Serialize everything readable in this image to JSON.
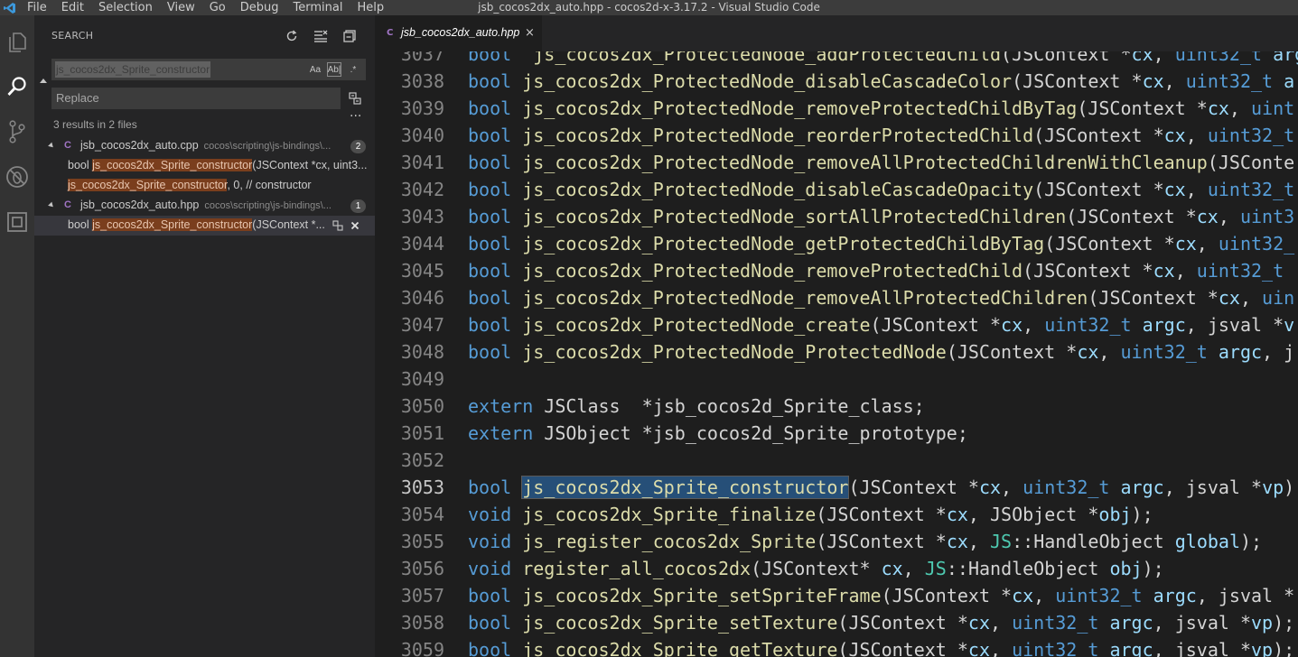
{
  "window": {
    "title": "jsb_cocos2dx_auto.hpp - cocos2d-x-3.17.2 - Visual Studio Code",
    "menu": [
      "File",
      "Edit",
      "Selection",
      "View",
      "Go",
      "Debug",
      "Terminal",
      "Help"
    ]
  },
  "activity_bar": {
    "items": [
      "explorer-icon",
      "search-icon",
      "source-control-icon",
      "debug-icon",
      "extensions-icon"
    ],
    "active": "search-icon"
  },
  "search": {
    "title": "SEARCH",
    "query": "js_cocos2dx_Sprite_constructor",
    "options": [
      "Aa",
      "Ab|",
      ".*"
    ],
    "replace_placeholder": "Replace",
    "more": "...",
    "results_summary": "3 results in 2 files",
    "files": [
      {
        "name": "jsb_cocos2dx_auto.cpp",
        "path": "cocos\\scripting\\js-bindings\\...",
        "icon": "C",
        "count": "2",
        "matches": [
          {
            "before": "bool ",
            "match": "js_cocos2dx_Sprite_constructor",
            "after": "(JSContext *cx, uint3..."
          },
          {
            "before": "",
            "match": "js_cocos2dx_Sprite_constructor",
            "after": ", 0, // constructor"
          }
        ]
      },
      {
        "name": "jsb_cocos2dx_auto.hpp",
        "path": "cocos\\scripting\\js-bindings\\...",
        "icon": "C",
        "count": "1",
        "matches": [
          {
            "before": "bool ",
            "match": "js_cocos2dx_Sprite_constructor",
            "after": "(JSContext *..."
          }
        ]
      }
    ]
  },
  "editor": {
    "tab_label": "jsb_cocos2dx_auto.hpp",
    "tab_icon": "C",
    "tab_close": "×",
    "current_line": "3053",
    "lines": [
      {
        "n": "3037",
        "tokens": [
          [
            "kw",
            "bool"
          ],
          [
            "",
            "  "
          ],
          [
            "fn",
            "js_cocos2dx_ProtectedNode_addProtectedChild"
          ],
          [
            "",
            "(JSContext *"
          ],
          [
            "pm",
            "cx"
          ],
          [
            "",
            ", "
          ],
          [
            "kw",
            "uint32_t"
          ],
          [
            "pm",
            " arg"
          ]
        ]
      },
      {
        "n": "3038",
        "tokens": [
          [
            "kw",
            "bool"
          ],
          [
            "",
            ""
          ],
          [
            "fn",
            " js_cocos2dx_ProtectedNode_disableCascadeColor"
          ],
          [
            "",
            "(JSContext *"
          ],
          [
            "pm",
            "cx"
          ],
          [
            "",
            ", "
          ],
          [
            "kw",
            "uint32_t"
          ],
          [
            "pm",
            " a"
          ]
        ]
      },
      {
        "n": "3039",
        "tokens": [
          [
            "kw",
            "bool"
          ],
          [
            "fn",
            " js_cocos2dx_ProtectedNode_removeProtectedChildByTag"
          ],
          [
            "",
            "(JSContext *"
          ],
          [
            "pm",
            "cx"
          ],
          [
            "",
            ", "
          ],
          [
            "kw",
            "uint"
          ]
        ]
      },
      {
        "n": "3040",
        "tokens": [
          [
            "kw",
            "bool"
          ],
          [
            "fn",
            " js_cocos2dx_ProtectedNode_reorderProtectedChild"
          ],
          [
            "",
            "(JSContext *"
          ],
          [
            "pm",
            "cx"
          ],
          [
            "",
            ", "
          ],
          [
            "kw",
            "uint32_t"
          ]
        ]
      },
      {
        "n": "3041",
        "tokens": [
          [
            "kw",
            "bool"
          ],
          [
            "fn",
            " js_cocos2dx_ProtectedNode_removeAllProtectedChildrenWithCleanup"
          ],
          [
            "",
            "(JSConte"
          ]
        ]
      },
      {
        "n": "3042",
        "tokens": [
          [
            "kw",
            "bool"
          ],
          [
            "fn",
            " js_cocos2dx_ProtectedNode_disableCascadeOpacity"
          ],
          [
            "",
            "(JSContext *"
          ],
          [
            "pm",
            "cx"
          ],
          [
            "",
            ", "
          ],
          [
            "kw",
            "uint32_t"
          ]
        ]
      },
      {
        "n": "3043",
        "tokens": [
          [
            "kw",
            "bool"
          ],
          [
            "fn",
            " js_cocos2dx_ProtectedNode_sortAllProtectedChildren"
          ],
          [
            "",
            "(JSContext *"
          ],
          [
            "pm",
            "cx"
          ],
          [
            "",
            ", "
          ],
          [
            "kw",
            "uint3"
          ]
        ]
      },
      {
        "n": "3044",
        "tokens": [
          [
            "kw",
            "bool"
          ],
          [
            "fn",
            " js_cocos2dx_ProtectedNode_getProtectedChildByTag"
          ],
          [
            "",
            "(JSContext *"
          ],
          [
            "pm",
            "cx"
          ],
          [
            "",
            ", "
          ],
          [
            "kw",
            "uint32_"
          ]
        ]
      },
      {
        "n": "3045",
        "tokens": [
          [
            "kw",
            "bool"
          ],
          [
            "fn",
            " js_cocos2dx_ProtectedNode_removeProtectedChild"
          ],
          [
            "",
            "(JSContext *"
          ],
          [
            "pm",
            "cx"
          ],
          [
            "",
            ", "
          ],
          [
            "kw",
            "uint32_t"
          ]
        ]
      },
      {
        "n": "3046",
        "tokens": [
          [
            "kw",
            "bool"
          ],
          [
            "fn",
            " js_cocos2dx_ProtectedNode_removeAllProtectedChildren"
          ],
          [
            "",
            "(JSContext *"
          ],
          [
            "pm",
            "cx"
          ],
          [
            "",
            ", "
          ],
          [
            "kw",
            "uin"
          ]
        ]
      },
      {
        "n": "3047",
        "tokens": [
          [
            "kw",
            "bool"
          ],
          [
            "fn",
            " js_cocos2dx_ProtectedNode_create"
          ],
          [
            "",
            "(JSContext *"
          ],
          [
            "pm",
            "cx"
          ],
          [
            "",
            ", "
          ],
          [
            "kw",
            "uint32_t"
          ],
          [
            "pm",
            " argc"
          ],
          [
            "",
            ", jsval *"
          ],
          [
            "pm",
            "v"
          ]
        ]
      },
      {
        "n": "3048",
        "tokens": [
          [
            "kw",
            "bool"
          ],
          [
            "fn",
            " js_cocos2dx_ProtectedNode_ProtectedNode"
          ],
          [
            "",
            "(JSContext *"
          ],
          [
            "pm",
            "cx"
          ],
          [
            "",
            ", "
          ],
          [
            "kw",
            "uint32_t"
          ],
          [
            "pm",
            " argc"
          ],
          [
            "",
            ", j"
          ]
        ]
      },
      {
        "n": "3049",
        "tokens": []
      },
      {
        "n": "3050",
        "tokens": [
          [
            "kw",
            "extern"
          ],
          [
            "",
            " JSClass  *jsb_cocos2d_Sprite_class;"
          ]
        ]
      },
      {
        "n": "3051",
        "tokens": [
          [
            "kw",
            "extern"
          ],
          [
            "",
            " JSObject *jsb_cocos2d_Sprite_prototype;"
          ]
        ]
      },
      {
        "n": "3052",
        "tokens": []
      },
      {
        "n": "3053",
        "tokens": [
          [
            "kw",
            "bool"
          ],
          [
            "",
            " "
          ],
          [
            "fn sel",
            "js_cocos2dx_Sprite_constructor"
          ],
          [
            "",
            "(JSContext *"
          ],
          [
            "pm",
            "cx"
          ],
          [
            "",
            ", "
          ],
          [
            "kw",
            "uint32_t"
          ],
          [
            "pm",
            " argc"
          ],
          [
            "",
            ", jsval *"
          ],
          [
            "pm",
            "vp"
          ],
          [
            "",
            ")"
          ]
        ]
      },
      {
        "n": "3054",
        "tokens": [
          [
            "kw",
            "void"
          ],
          [
            "fn",
            " js_cocos2dx_Sprite_finalize"
          ],
          [
            "",
            "(JSContext *"
          ],
          [
            "pm",
            "cx"
          ],
          [
            "",
            ", JSObject *"
          ],
          [
            "pm",
            "obj"
          ],
          [
            "",
            ");"
          ]
        ]
      },
      {
        "n": "3055",
        "tokens": [
          [
            "kw",
            "void"
          ],
          [
            "fn",
            " js_register_cocos2dx_Sprite"
          ],
          [
            "",
            "(JSContext *"
          ],
          [
            "pm",
            "cx"
          ],
          [
            "",
            ", "
          ],
          [
            "ty",
            "JS"
          ],
          [
            "",
            "::HandleObject "
          ],
          [
            "pm",
            "global"
          ],
          [
            "",
            ");"
          ]
        ]
      },
      {
        "n": "3056",
        "tokens": [
          [
            "kw",
            "void"
          ],
          [
            "fn",
            " register_all_cocos2dx"
          ],
          [
            "",
            "(JSContext* "
          ],
          [
            "pm",
            "cx"
          ],
          [
            "",
            ", "
          ],
          [
            "ty",
            "JS"
          ],
          [
            "",
            "::HandleObject "
          ],
          [
            "pm",
            "obj"
          ],
          [
            "",
            ");"
          ]
        ]
      },
      {
        "n": "3057",
        "tokens": [
          [
            "kw",
            "bool"
          ],
          [
            "fn",
            " js_cocos2dx_Sprite_setSpriteFrame"
          ],
          [
            "",
            "(JSContext *"
          ],
          [
            "pm",
            "cx"
          ],
          [
            "",
            ", "
          ],
          [
            "kw",
            "uint32_t"
          ],
          [
            "pm",
            " argc"
          ],
          [
            "",
            ", jsval *"
          ]
        ]
      },
      {
        "n": "3058",
        "tokens": [
          [
            "kw",
            "bool"
          ],
          [
            "fn",
            " js_cocos2dx_Sprite_setTexture"
          ],
          [
            "",
            "(JSContext *"
          ],
          [
            "pm",
            "cx"
          ],
          [
            "",
            ", "
          ],
          [
            "kw",
            "uint32_t"
          ],
          [
            "pm",
            " argc"
          ],
          [
            "",
            ", jsval *"
          ],
          [
            "pm",
            "vp"
          ],
          [
            "",
            ");"
          ]
        ]
      },
      {
        "n": "3059",
        "tokens": [
          [
            "kw",
            "bool"
          ],
          [
            "fn",
            " js_cocos2dx_Sprite_getTexture"
          ],
          [
            "",
            "(JSContext *"
          ],
          [
            "pm",
            "cx"
          ],
          [
            "",
            ", "
          ],
          [
            "kw",
            "uint32_t"
          ],
          [
            "pm",
            " argc"
          ],
          [
            "",
            ", jsval *"
          ],
          [
            "pm",
            "vp"
          ],
          [
            "",
            ");"
          ]
        ]
      }
    ]
  },
  "colors": {
    "keyword": "#569cd6",
    "function": "#dcdcaa",
    "param": "#9cdcfe",
    "type": "#4ec9b0",
    "match_highlight": "#7a3e1d",
    "selection": "#264f78"
  }
}
